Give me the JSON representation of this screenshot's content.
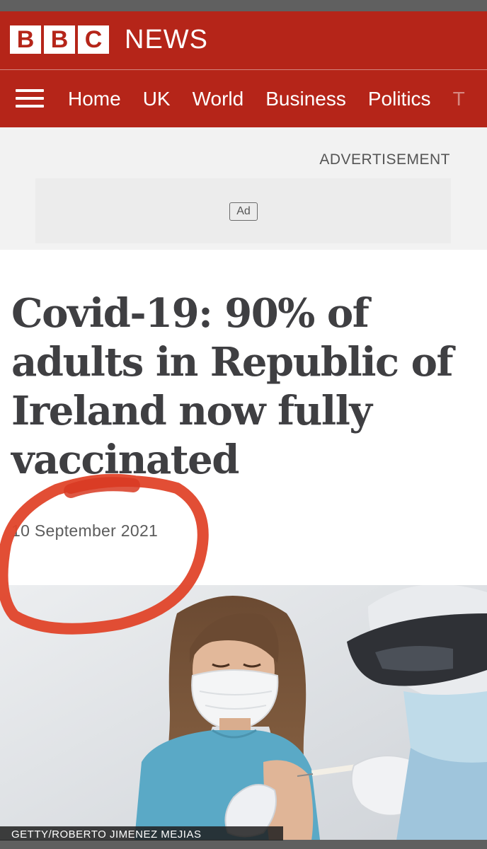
{
  "brand": {
    "letters": [
      "B",
      "B",
      "C"
    ],
    "name": "NEWS",
    "color": "#b52519"
  },
  "nav": {
    "items": [
      "Home",
      "UK",
      "World",
      "Business",
      "Politics",
      "T"
    ]
  },
  "ad": {
    "label": "ADVERTISEMENT",
    "badge": "Ad"
  },
  "article": {
    "headline": "Covid-19: 90% of adults in Republic of Ireland now fully vaccinated",
    "date": "10 September 2021"
  },
  "photo": {
    "credit": "GETTY/ROBERTO JIMENEZ MEJIAS"
  },
  "icons": {
    "menu": "hamburger-menu-icon"
  },
  "annotation": {
    "color": "#e0452a"
  }
}
